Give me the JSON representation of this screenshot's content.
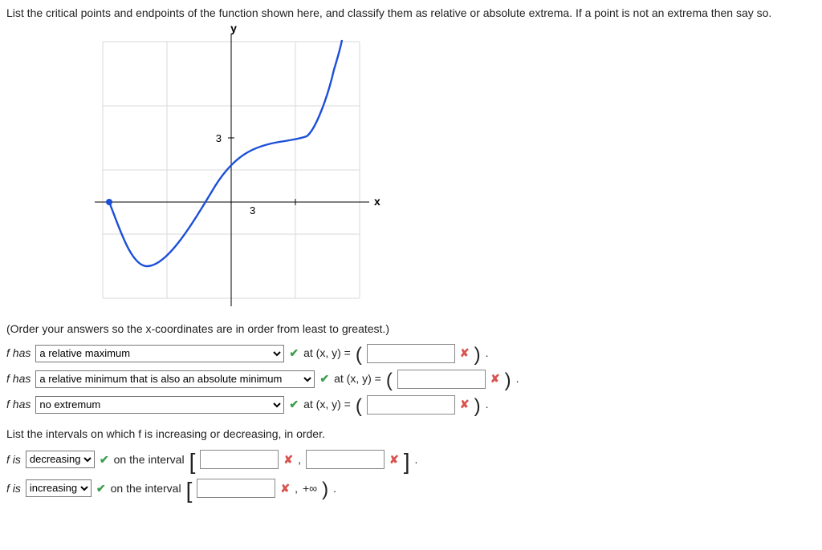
{
  "question": "List the critical points and endpoints of the function shown here, and classify them as relative or absolute extrema. If a point is not an extrema then say so.",
  "order_hint": "(Order your answers so the x-coordinates are in order from least to greatest.)",
  "axis": {
    "x_label": "x",
    "y_label": "y",
    "tick_x": "3",
    "tick_y": "3"
  },
  "classify": {
    "lead": "f has",
    "opts1": "a relative maximum",
    "opts2": "a relative minimum that is also an absolute minimum",
    "opts3": "no extremum",
    "at_xy": "at  (x, y)  =",
    "trail_period": "."
  },
  "intervals_lead": "List the intervals on which f is increasing or decreasing, in order.",
  "intervals": {
    "lead": "f is",
    "dec": "decreasing",
    "inc": "increasing",
    "on": "on the interval",
    "comma": ",",
    "plus_inf": "+∞",
    "period": "."
  },
  "chart_data": {
    "type": "line",
    "title": "",
    "xlabel": "x",
    "ylabel": "y",
    "xlim": [
      -6,
      6
    ],
    "ylim": [
      -6,
      8
    ],
    "x": [
      -5.8,
      -5.0,
      -4.0,
      -3.0,
      -2.0,
      -1.0,
      0.0,
      1.0,
      2.0,
      3.0,
      4.0,
      5.0,
      5.4
    ],
    "y": [
      0.0,
      -2.0,
      -3.0,
      -2.4,
      -1.2,
      0.2,
      1.5,
      2.4,
      2.9,
      3.0,
      3.3,
      5.5,
      8.0
    ],
    "critical_points": [
      {
        "x": -5.8,
        "y": 0,
        "label": "endpoint / relative maximum"
      },
      {
        "x": -4.0,
        "y": -3,
        "label": "relative & absolute minimum"
      },
      {
        "x": 3.0,
        "y": 3,
        "label": "inflection / no extremum"
      }
    ]
  }
}
